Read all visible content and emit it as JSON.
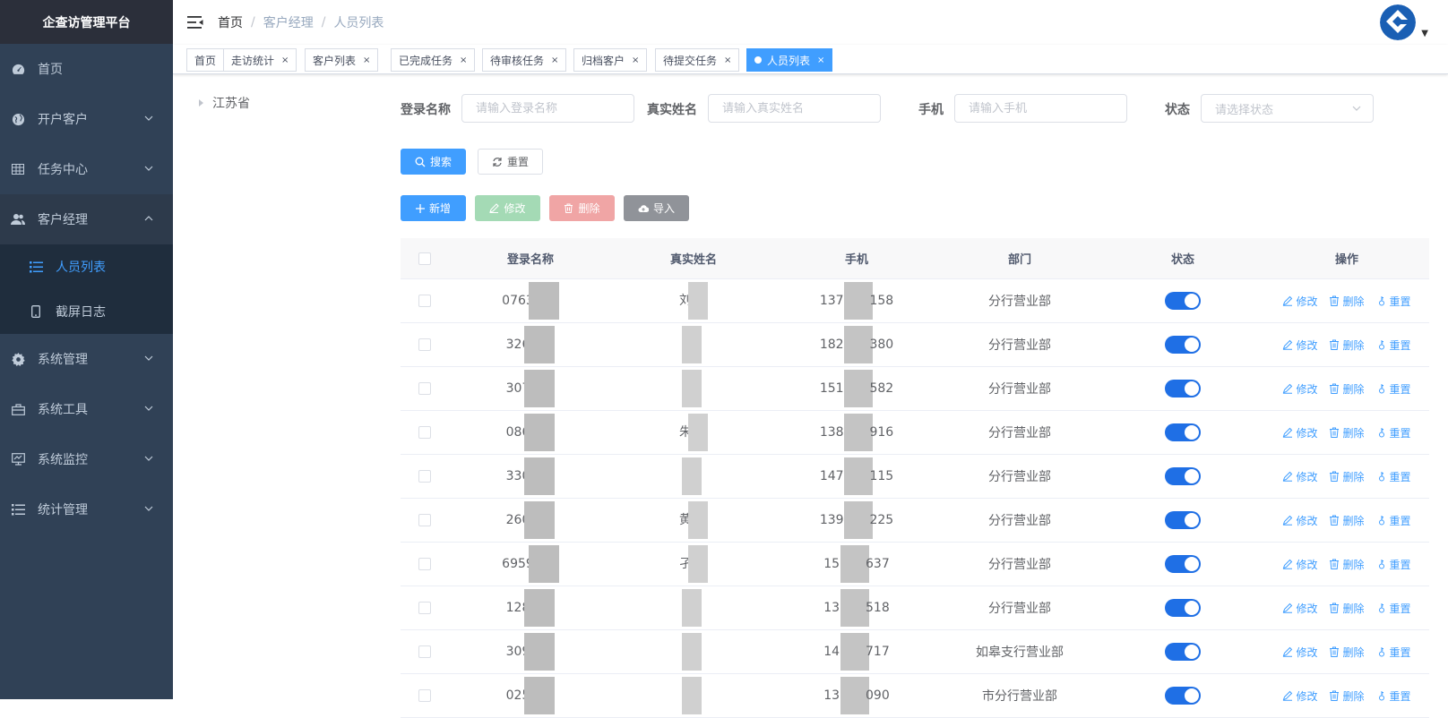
{
  "app": {
    "title": "企查访管理平台"
  },
  "sidebar": {
    "items": [
      {
        "label": "首页",
        "icon": "dashboard-icon",
        "expandable": false
      },
      {
        "label": "开户客户",
        "icon": "globe-icon",
        "expandable": true
      },
      {
        "label": "任务中心",
        "icon": "grid-icon",
        "expandable": true
      },
      {
        "label": "客户经理",
        "icon": "peoples-icon",
        "expandable": true,
        "open": true,
        "children": [
          {
            "label": "人员列表",
            "icon": "list-icon",
            "active": true
          },
          {
            "label": "截屏日志",
            "icon": "phone-icon"
          }
        ]
      },
      {
        "label": "系统管理",
        "icon": "gear-icon",
        "expandable": true
      },
      {
        "label": "系统工具",
        "icon": "toolbox-icon",
        "expandable": true
      },
      {
        "label": "系统监控",
        "icon": "monitor-icon",
        "expandable": true
      },
      {
        "label": "统计管理",
        "icon": "list-icon",
        "expandable": true
      }
    ]
  },
  "breadcrumb": [
    "首页",
    "客户经理",
    "人员列表"
  ],
  "tags": [
    {
      "label": "首页",
      "closable": false
    },
    {
      "label": "走访统计",
      "closable": true
    },
    {
      "label": "客户列表",
      "closable": true
    },
    {
      "label": "已完成任务",
      "closable": true
    },
    {
      "label": "待审核任务",
      "closable": true
    },
    {
      "label": "归档客户",
      "closable": true
    },
    {
      "label": "待提交任务",
      "closable": true
    },
    {
      "label": "人员列表",
      "closable": true,
      "active": true
    }
  ],
  "tree": {
    "root": "江苏省"
  },
  "search": {
    "login_label": "登录名称",
    "login_placeholder": "请输入登录名称",
    "name_label": "真实姓名",
    "name_placeholder": "请输入真实姓名",
    "phone_label": "手机",
    "phone_placeholder": "请输入手机",
    "status_label": "状态",
    "status_placeholder": "请选择状态",
    "search_btn": "搜索",
    "reset_btn": "重置"
  },
  "toolbar": {
    "add": "新增",
    "edit": "修改",
    "delete": "删除",
    "import": "导入"
  },
  "table": {
    "headers": {
      "login": "登录名称",
      "name": "真实姓名",
      "phone": "手机",
      "dept": "部门",
      "status": "状态",
      "ops": "操作"
    },
    "ops": {
      "edit": "修改",
      "delete": "删除",
      "reset": "重置"
    },
    "rows": [
      {
        "login": "0763",
        "name": "刘",
        "phone_a": "1377",
        "phone_b": "158",
        "dept": "分行营业部",
        "status": true
      },
      {
        "login": "326",
        "name": "",
        "phone_a": "1825",
        "phone_b": "380",
        "dept": "分行营业部",
        "status": true
      },
      {
        "login": "307",
        "name": "",
        "phone_a": "1515",
        "phone_b": "582",
        "dept": "分行营业部",
        "status": true
      },
      {
        "login": "086",
        "name": "朱",
        "phone_a": "1381",
        "phone_b": "916",
        "dept": "分行营业部",
        "status": true
      },
      {
        "login": "330",
        "name": "",
        "phone_a": "1475",
        "phone_b": "115",
        "dept": "分行营业部",
        "status": true
      },
      {
        "login": "260",
        "name": "黄",
        "phone_a": "1391",
        "phone_b": "225",
        "dept": "分行营业部",
        "status": true
      },
      {
        "login": "6959",
        "name": "孑",
        "phone_a": "158",
        "phone_b": "637",
        "dept": "分行营业部",
        "status": true
      },
      {
        "login": "128",
        "name": "",
        "phone_a": "138",
        "phone_b": "518",
        "dept": "分行营业部",
        "status": true
      },
      {
        "login": "309",
        "name": "",
        "phone_a": "147",
        "phone_b": "717",
        "dept": "如皋支行营业部",
        "status": true
      },
      {
        "login": "025",
        "name": "",
        "phone_a": "138",
        "phone_b": "090",
        "dept": "市分行营业部",
        "status": true
      }
    ]
  }
}
